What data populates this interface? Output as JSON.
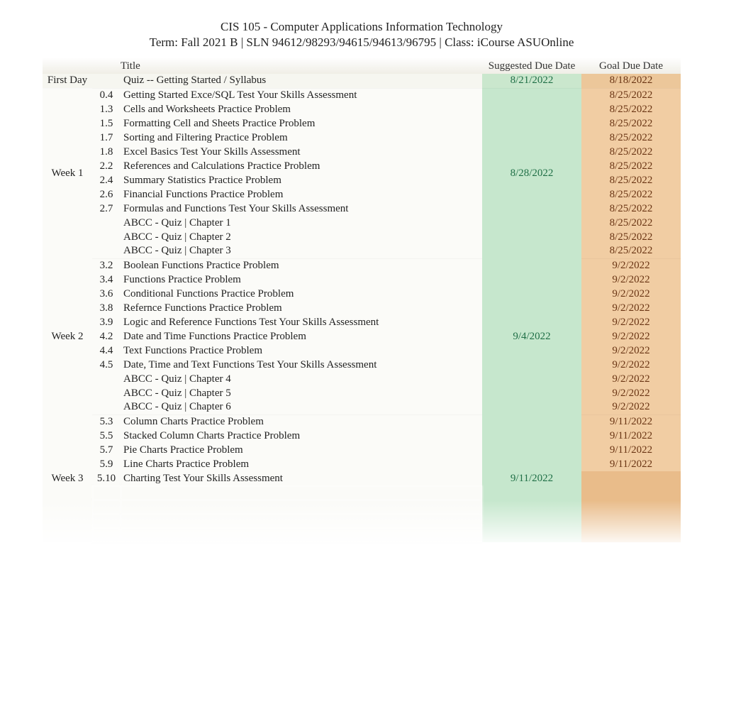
{
  "header": {
    "title": "CIS 105 - Computer Applications Information Technology",
    "subtitle": "Term: Fall 2021 B | SLN 94612/98293/94615/94613/96795   | Class: iCourse ASUOnline"
  },
  "columns": {
    "week": "",
    "num": "",
    "title": "Title",
    "suggested": "Suggested Due Date",
    "goal": "Goal Due Date"
  },
  "groups": [
    {
      "week_label": "First Day",
      "suggested": "8/21/2022",
      "rows": [
        {
          "num": "",
          "title": "Quiz -- Getting Started / Syllabus",
          "goal": "8/18/2022"
        }
      ]
    },
    {
      "week_label": "Week 1",
      "suggested": "8/28/2022",
      "rows": [
        {
          "num": "0.4",
          "title": "Getting Started Exce/SQL Test Your Skills Assessment",
          "goal": "8/25/2022"
        },
        {
          "num": "1.3",
          "title": "Cells and Worksheets Practice Problem",
          "goal": "8/25/2022"
        },
        {
          "num": "1.5",
          "title": "Formatting Cell and Sheets Practice Problem",
          "goal": "8/25/2022"
        },
        {
          "num": "1.7",
          "title": "Sorting and Filtering Practice Problem",
          "goal": "8/25/2022"
        },
        {
          "num": "1.8",
          "title": "Excel Basics Test Your Skills Assessment",
          "goal": "8/25/2022"
        },
        {
          "num": "2.2",
          "title": "References and Calculations Practice Problem",
          "goal": "8/25/2022"
        },
        {
          "num": "2.4",
          "title": "Summary Statistics Practice Problem",
          "goal": "8/25/2022"
        },
        {
          "num": "2.6",
          "title": "Financial Functions Practice Problem",
          "goal": "8/25/2022"
        },
        {
          "num": "2.7",
          "title": "Formulas and Functions Test Your Skills Assessment",
          "goal": "8/25/2022"
        },
        {
          "num": "",
          "title": "ABCC - Quiz | Chapter 1",
          "goal": "8/25/2022"
        },
        {
          "num": "",
          "title": "ABCC - Quiz | Chapter 2",
          "goal": "8/25/2022"
        },
        {
          "num": "",
          "title": "ABCC - Quiz | Chapter 3",
          "goal": "8/25/2022"
        }
      ]
    },
    {
      "week_label": "Week 2",
      "suggested": "9/4/2022",
      "rows": [
        {
          "num": "3.2",
          "title": "Boolean Functions Practice Problem",
          "goal": "9/2/2022"
        },
        {
          "num": "3.4",
          "title": "Functions Practice Problem",
          "goal": "9/2/2022"
        },
        {
          "num": "3.6",
          "title": "Conditional Functions Practice Problem",
          "goal": "9/2/2022"
        },
        {
          "num": "3.8",
          "title": "Refernce Functions Practice Problem",
          "goal": "9/2/2022"
        },
        {
          "num": "3.9",
          "title": "Logic and Reference Functions Test Your Skills Assessment",
          "goal": "9/2/2022"
        },
        {
          "num": "4.2",
          "title": "Date and Time Functions Practice Problem",
          "goal": "9/2/2022"
        },
        {
          "num": "4.4",
          "title": "Text Functions Practice Problem",
          "goal": "9/2/2022"
        },
        {
          "num": "4.5",
          "title": "Date, Time and Text Functions Test Your Skills Assessment",
          "goal": "9/2/2022"
        },
        {
          "num": "",
          "title": "ABCC - Quiz | Chapter 4",
          "goal": "9/2/2022"
        },
        {
          "num": "",
          "title": "ABCC - Quiz | Chapter 5",
          "goal": "9/2/2022"
        },
        {
          "num": "",
          "title": "ABCC - Quiz | Chapter 6",
          "goal": "9/2/2022"
        }
      ]
    },
    {
      "week_label": "Week 3",
      "suggested": "9/11/2022",
      "rows": [
        {
          "num": "5.3",
          "title": "Column Charts Practice Problem",
          "goal": "9/11/2022"
        },
        {
          "num": "5.5",
          "title": "Stacked Column Charts Practice Problem",
          "goal": "9/11/2022"
        },
        {
          "num": "5.7",
          "title": "Pie Charts Practice Problem",
          "goal": "9/11/2022"
        },
        {
          "num": "5.9",
          "title": "Line Charts Practice Problem",
          "goal": "9/11/2022"
        },
        {
          "num": "5.10",
          "title": "Charting Test Your Skills Assessment",
          "goal": ""
        },
        {
          "num": "",
          "title": "",
          "goal": "",
          "obscured": true
        },
        {
          "num": "",
          "title": "",
          "goal": "",
          "obscured": true
        },
        {
          "num": "",
          "title": "",
          "goal": "",
          "obscured": true
        },
        {
          "num": "",
          "title": "",
          "goal": "",
          "obscured": true
        }
      ]
    }
  ]
}
